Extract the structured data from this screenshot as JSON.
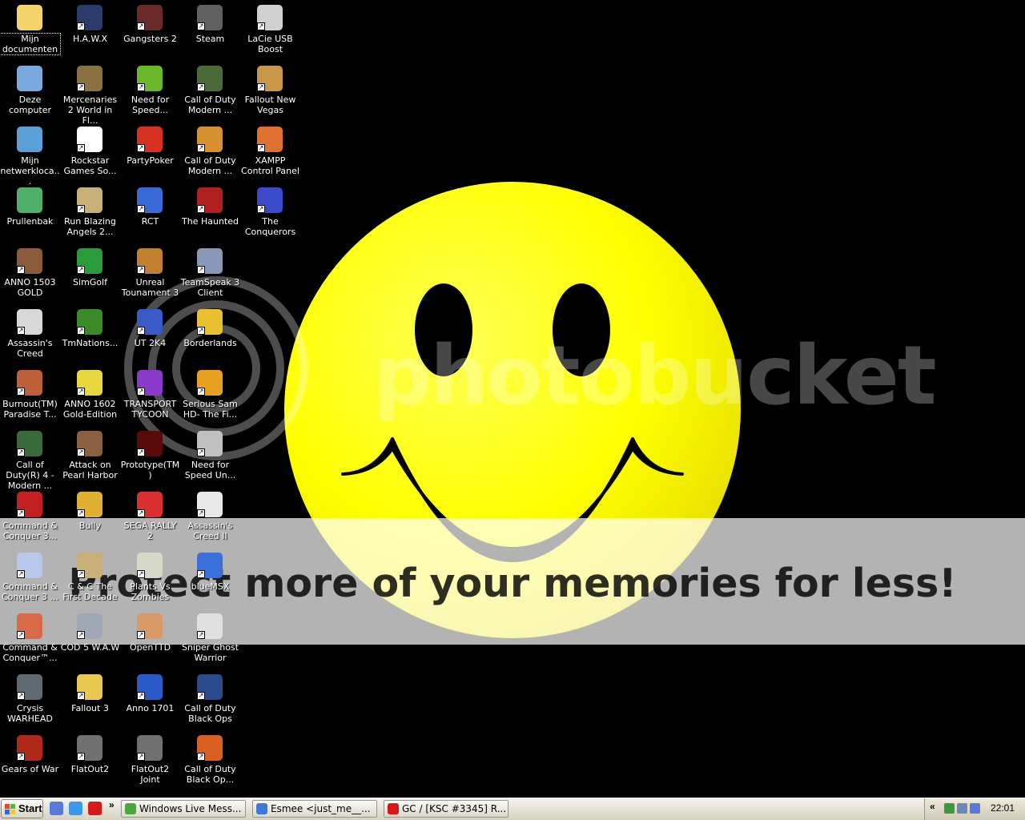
{
  "desktop": {
    "watermark": {
      "logo_text": "photobucket",
      "banner_text": "Protect more of your memories for less!"
    },
    "icons": [
      {
        "label": "Mijn documenten",
        "icon": "folder-icon",
        "color": "#f3d36a",
        "col": 0,
        "row": 0,
        "selected": true
      },
      {
        "label": "Deze computer",
        "icon": "computer-icon",
        "color": "#7aa9e0",
        "col": 0,
        "row": 1
      },
      {
        "label": "Mijn netwerkloca...",
        "icon": "network-places-icon",
        "color": "#5aa0d8",
        "col": 0,
        "row": 2
      },
      {
        "label": "Prullenbak",
        "icon": "recycle-bin-icon",
        "color": "#4fb06a",
        "col": 0,
        "row": 3
      },
      {
        "label": "ANNO 1503 GOLD",
        "icon": "anno-1503-icon",
        "color": "#8a5a3a",
        "col": 0,
        "row": 4
      },
      {
        "label": "Assassin's Creed",
        "icon": "assassins-creed-icon",
        "color": "#d8d8d8",
        "col": 0,
        "row": 5
      },
      {
        "label": "Burnout(TM) Paradise T...",
        "icon": "burnout-icon",
        "color": "#c0603a",
        "col": 0,
        "row": 6
      },
      {
        "label": "Call of Duty(R) 4 - Modern ...",
        "icon": "cod4-icon",
        "color": "#3a6a3a",
        "col": 0,
        "row": 7
      },
      {
        "label": "Command & Conquer 3...",
        "icon": "cnc3-icon",
        "color": "#c02020",
        "col": 0,
        "row": 8
      },
      {
        "label": "Command & Conquer 3 ...",
        "icon": "cnc3-kanes-wrath-icon",
        "color": "#b8c8e8",
        "col": 0,
        "row": 9
      },
      {
        "label": "Command & Conquer™...",
        "icon": "cnc-red-alert-icon",
        "color": "#d86a4a",
        "col": 0,
        "row": 10
      },
      {
        "label": "Crysis WARHEAD",
        "icon": "crysis-warhead-icon",
        "color": "#606870",
        "col": 0,
        "row": 11
      },
      {
        "label": "Gears of War",
        "icon": "gears-of-war-icon",
        "color": "#b02818",
        "col": 0,
        "row": 12
      },
      {
        "label": "H.A.W.X",
        "icon": "hawx-icon",
        "color": "#2a3a6a",
        "col": 1,
        "row": 0
      },
      {
        "label": "Mercenaries 2 World in Fl...",
        "icon": "mercenaries-2-icon",
        "color": "#8a7040",
        "col": 1,
        "row": 1
      },
      {
        "label": "Rockstar Games So...",
        "icon": "rockstar-icon",
        "color": "#ffffff",
        "col": 1,
        "row": 2
      },
      {
        "label": "Run Blazing Angels 2...",
        "icon": "blazing-angels-icon",
        "color": "#c8b078",
        "col": 1,
        "row": 3
      },
      {
        "label": "SimGolf",
        "icon": "simgolf-icon",
        "color": "#2a9a3a",
        "col": 1,
        "row": 4
      },
      {
        "label": "TmNations...",
        "icon": "tmnations-icon",
        "color": "#3a8a2a",
        "col": 1,
        "row": 5
      },
      {
        "label": "ANNO 1602 Gold-Edition",
        "icon": "anno-1602-icon",
        "color": "#e8d840",
        "col": 1,
        "row": 6
      },
      {
        "label": "Attack on Pearl Harbor",
        "icon": "pearl-harbor-icon",
        "color": "#8a6040",
        "col": 1,
        "row": 7
      },
      {
        "label": "Bully",
        "icon": "bully-icon",
        "color": "#e0b030",
        "col": 1,
        "row": 8
      },
      {
        "label": "C & C The First Decade",
        "icon": "cnc-first-decade-icon",
        "color": "#c8b078",
        "col": 1,
        "row": 9
      },
      {
        "label": "COD 5 W.A.W",
        "icon": "cod5-waw-icon",
        "color": "#a0a8b8",
        "col": 1,
        "row": 10
      },
      {
        "label": "Fallout 3",
        "icon": "fallout-3-icon",
        "color": "#e8c850",
        "col": 1,
        "row": 11
      },
      {
        "label": "FlatOut2",
        "icon": "flatout2-icon",
        "color": "#707070",
        "col": 1,
        "row": 12
      },
      {
        "label": "Gangsters 2",
        "icon": "gangsters-2-icon",
        "color": "#6a2a2a",
        "col": 2,
        "row": 0
      },
      {
        "label": "Need for Speed...",
        "icon": "nfs-icon",
        "color": "#6ab82a",
        "col": 2,
        "row": 1
      },
      {
        "label": "PartyPoker",
        "icon": "partypoker-icon",
        "color": "#d83020",
        "col": 2,
        "row": 2
      },
      {
        "label": "RCT",
        "icon": "rct-icon",
        "color": "#3a6ad8",
        "col": 2,
        "row": 3
      },
      {
        "label": "Unreal Tounament 3",
        "icon": "ut3-icon",
        "color": "#c08030",
        "col": 2,
        "row": 4
      },
      {
        "label": "UT 2K4",
        "icon": "ut2k4-icon",
        "color": "#3a5ac8",
        "col": 2,
        "row": 5
      },
      {
        "label": "TRANSPORT TYCOON",
        "icon": "transport-tycoon-icon",
        "color": "#8a3ac8",
        "col": 2,
        "row": 6
      },
      {
        "label": "Prototype(TM)",
        "icon": "prototype-icon",
        "color": "#5a0a0a",
        "col": 2,
        "row": 7
      },
      {
        "label": "SEGA RALLY 2",
        "icon": "sega-rally-icon",
        "color": "#d83030",
        "col": 2,
        "row": 8
      },
      {
        "label": "Plants Vs Zombies",
        "icon": "pvz-icon",
        "color": "#d8d8c8",
        "col": 2,
        "row": 9
      },
      {
        "label": "OpenTTD",
        "icon": "openttd-icon",
        "color": "#d89868",
        "col": 2,
        "row": 10
      },
      {
        "label": "Anno 1701",
        "icon": "anno-1701-icon",
        "color": "#2a5ac8",
        "col": 2,
        "row": 11
      },
      {
        "label": "FlatOut2 Joint",
        "icon": "flatout2-joint-icon",
        "color": "#707070",
        "col": 2,
        "row": 12
      },
      {
        "label": "Steam",
        "icon": "steam-icon",
        "color": "#606060",
        "col": 3,
        "row": 0
      },
      {
        "label": "Call of Duty Modern ...",
        "icon": "cod-mw2-icon",
        "color": "#4a6a3a",
        "col": 3,
        "row": 1
      },
      {
        "label": "Call of Duty Modern ...",
        "icon": "cod-mw2-mp-icon",
        "color": "#d89030",
        "col": 3,
        "row": 2
      },
      {
        "label": "The Haunted",
        "icon": "the-haunted-icon",
        "color": "#b02020",
        "col": 3,
        "row": 3
      },
      {
        "label": "TeamSpeak 3 Client",
        "icon": "teamspeak-icon",
        "color": "#8a98b8",
        "col": 3,
        "row": 4
      },
      {
        "label": "Borderlands",
        "icon": "borderlands-icon",
        "color": "#e8c030",
        "col": 3,
        "row": 5
      },
      {
        "label": "Serious Sam HD- The Fi...",
        "icon": "serious-sam-icon",
        "color": "#e8a020",
        "col": 3,
        "row": 6
      },
      {
        "label": "Need for Speed Un...",
        "icon": "nfs-undercover-icon",
        "color": "#c0c0c0",
        "col": 3,
        "row": 7
      },
      {
        "label": "Assassin's Creed II",
        "icon": "assassins-creed-2-icon",
        "color": "#e8e8e8",
        "col": 3,
        "row": 8
      },
      {
        "label": "blueMSX",
        "icon": "bluemsx-icon",
        "color": "#3a70d8",
        "col": 3,
        "row": 9
      },
      {
        "label": "Sniper Ghost Warrior",
        "icon": "sniper-ghost-icon",
        "color": "#e0e0e0",
        "col": 3,
        "row": 10
      },
      {
        "label": "Call of Duty Black Ops",
        "icon": "cod-black-ops-icon",
        "color": "#2a4a8a",
        "col": 3,
        "row": 11
      },
      {
        "label": "Call of Duty Black Op...",
        "icon": "cod-black-ops-mp-icon",
        "color": "#d86020",
        "col": 3,
        "row": 12
      },
      {
        "label": "LaCie USB Boost",
        "icon": "lacie-icon",
        "color": "#d0d0d0",
        "col": 4,
        "row": 0
      },
      {
        "label": "Fallout New Vegas",
        "icon": "fallout-nv-icon",
        "color": "#c89848",
        "col": 4,
        "row": 1
      },
      {
        "label": "XAMPP Control Panel",
        "icon": "xampp-icon",
        "color": "#e07030",
        "col": 4,
        "row": 2
      },
      {
        "label": "The Conquerors",
        "icon": "the-conquerors-icon",
        "color": "#3a4ac8",
        "col": 4,
        "row": 3
      }
    ]
  },
  "taskbar": {
    "start_label": "Start",
    "quick_launch": [
      {
        "icon": "show-desktop-icon",
        "color": "#5a7ad8"
      },
      {
        "icon": "media-player-icon",
        "color": "#3a9ae8"
      },
      {
        "icon": "opera-icon",
        "color": "#d81818"
      }
    ],
    "overflow_chevron": "»",
    "tasks": [
      {
        "label": "Windows Live Mess...",
        "icon": "messenger-icon",
        "color": "#4aa83a"
      },
      {
        "label": "Esmee <just_me__...",
        "icon": "conversation-icon",
        "color": "#3a7ad8"
      },
      {
        "label": "GC / [KSC #3345] R...",
        "icon": "opera-icon",
        "color": "#d81818"
      }
    ],
    "tray": {
      "expand_label": "«",
      "icons": [
        {
          "icon": "network-tray-icon",
          "color": "#3a9a3a"
        },
        {
          "icon": "usb-tray-icon",
          "color": "#6a8ab8"
        },
        {
          "icon": "display-tray-icon",
          "color": "#5a7ad8"
        }
      ],
      "clock": "22:01"
    }
  }
}
